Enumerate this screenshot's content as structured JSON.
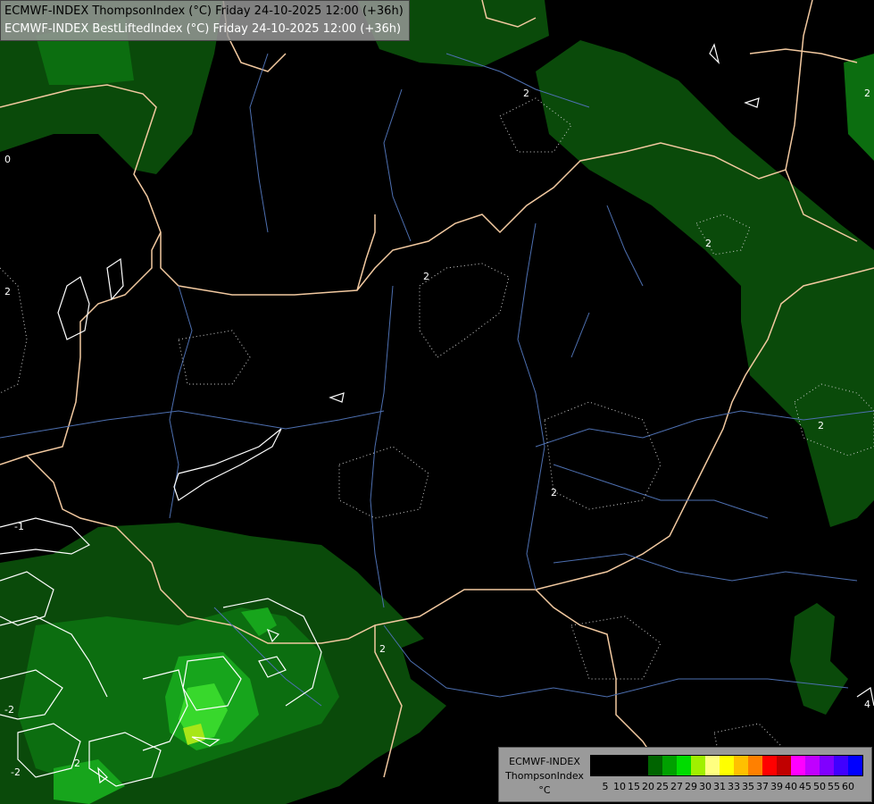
{
  "header": {
    "line1": "ECMWF-INDEX ThompsonIndex (°C) Friday 24-10-2025 12:00 (+36h)",
    "line2": "ECMWF-INDEX BestLiftedIndex (°C) Friday 24-10-2025 12:00 (+36h)"
  },
  "legend": {
    "model": "ECMWF-INDEX",
    "parameter": "ThompsonIndex",
    "unit": "°C",
    "colors": [
      "#000000",
      "#000000",
      "#000000",
      "#000000",
      "#006400",
      "#00a000",
      "#00dc00",
      "#a0f000",
      "#ffff80",
      "#ffff00",
      "#ffc000",
      "#ff8000",
      "#ff0000",
      "#c00000",
      "#ff00ff",
      "#c000ff",
      "#8000ff",
      "#4000ff",
      "#0000ff"
    ],
    "ticks": [
      "5",
      "10",
      "15",
      "20",
      "25",
      "27",
      "29",
      "30",
      "31",
      "33",
      "35",
      "37",
      "39",
      "40",
      "45",
      "50",
      "55",
      "60"
    ]
  },
  "contour_labels": [
    {
      "text": "2"
    },
    {
      "text": "0"
    },
    {
      "text": "2"
    },
    {
      "text": "2"
    },
    {
      "text": "2"
    },
    {
      "text": "2"
    },
    {
      "text": "2"
    },
    {
      "text": "-1"
    },
    {
      "text": "-2"
    },
    {
      "text": "2"
    },
    {
      "text": "-2"
    },
    {
      "text": "2"
    },
    {
      "text": "4"
    },
    {
      "text": "2"
    }
  ]
}
